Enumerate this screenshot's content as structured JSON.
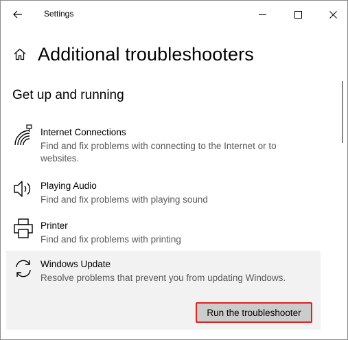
{
  "window": {
    "title": "Settings"
  },
  "page": {
    "title": "Additional troubleshooters",
    "section": "Get up and running"
  },
  "troubleshooters": [
    {
      "name": "Internet Connections",
      "description": "Find and fix problems with connecting to the Internet or to websites.",
      "icon": "wifi-signal-icon"
    },
    {
      "name": "Playing Audio",
      "description": "Find and fix problems with playing sound",
      "icon": "speaker-icon"
    },
    {
      "name": "Printer",
      "description": "Find and fix problems with printing",
      "icon": "printer-icon"
    },
    {
      "name": "Windows Update",
      "description": "Resolve problems that prevent you from updating Windows.",
      "icon": "sync-icon",
      "selected": true,
      "action_label": "Run the troubleshooter"
    }
  ],
  "colors": {
    "selected_bg": "#f2f2f2",
    "button_bg": "#cccccc",
    "highlight_border": "#e02020",
    "secondary_text": "#5a5a5a"
  }
}
